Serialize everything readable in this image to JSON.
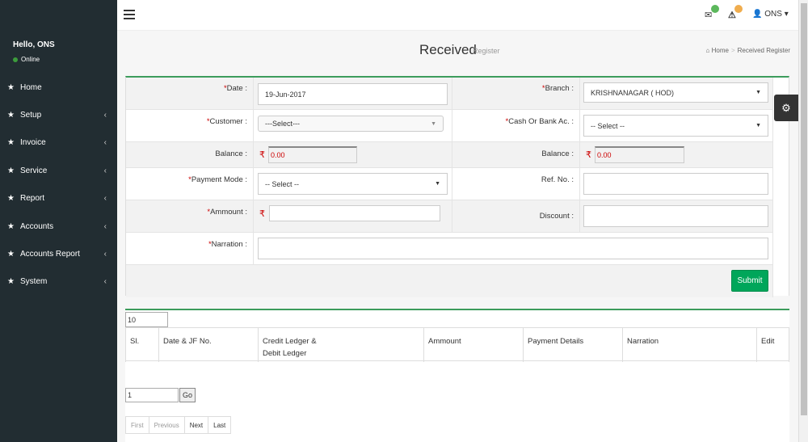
{
  "sidebar": {
    "greeting": "Hello, ONS",
    "status": "Online",
    "status_color": "#3c9c3c",
    "items": [
      {
        "label": "Home",
        "icon": "star-icon",
        "has_children": false
      },
      {
        "label": "Setup",
        "icon": "star-icon",
        "has_children": true
      },
      {
        "label": "Invoice",
        "icon": "star-icon",
        "has_children": true
      },
      {
        "label": "Service",
        "icon": "star-icon",
        "has_children": true
      },
      {
        "label": "Report",
        "icon": "star-icon",
        "has_children": true
      },
      {
        "label": "Accounts",
        "icon": "star-icon",
        "has_children": true
      },
      {
        "label": "Accounts Report",
        "icon": "star-icon",
        "has_children": true
      },
      {
        "label": "System",
        "icon": "star-icon",
        "has_children": true
      }
    ]
  },
  "topbar": {
    "user": "ONS",
    "mail_badge_color": "#5cb85c",
    "alert_badge_color": "#f0ad4e"
  },
  "page": {
    "title": "Received",
    "subtitle": "Register",
    "breadcrumb": [
      "Home",
      "Received Register"
    ]
  },
  "form": {
    "date_label": "Date :",
    "date_value": "19-Jun-2017",
    "branch_label": "Branch :",
    "branch_value": "KRISHNANAGAR ( HOD)",
    "customer_label": "Customer :",
    "customer_value": "---Select---",
    "cash_bank_label": "Cash Or Bank Ac. :",
    "cash_bank_value": "-- Select --",
    "balance_label": "Balance :",
    "balance_left": "0.00",
    "balance_right_label": "Balance :",
    "balance_right": "0.00",
    "payment_mode_label": "Payment Mode :",
    "payment_mode_value": "-- Select --",
    "ref_label": "Ref. No. :",
    "ref_value": "",
    "amount_label": "Ammount :",
    "amount_value": "",
    "discount_label": "Discount :",
    "discount_value": "",
    "narration_label": "Narration :",
    "narration_value": "",
    "submit_label": "Submit",
    "currency_symbol": "₹",
    "required_mark": "*"
  },
  "table": {
    "page_size": "10",
    "columns": [
      "Sl.",
      "Date & JF No.",
      "Credit Ledger &",
      "Debit Ledger",
      "Ammount",
      "Payment Details",
      "Narration",
      "Edit"
    ],
    "rows": [],
    "page_number": "1",
    "go_label": "Go",
    "pager": [
      "First",
      "Previous",
      "Next",
      "Last"
    ]
  },
  "accent_color": "#00a65a"
}
